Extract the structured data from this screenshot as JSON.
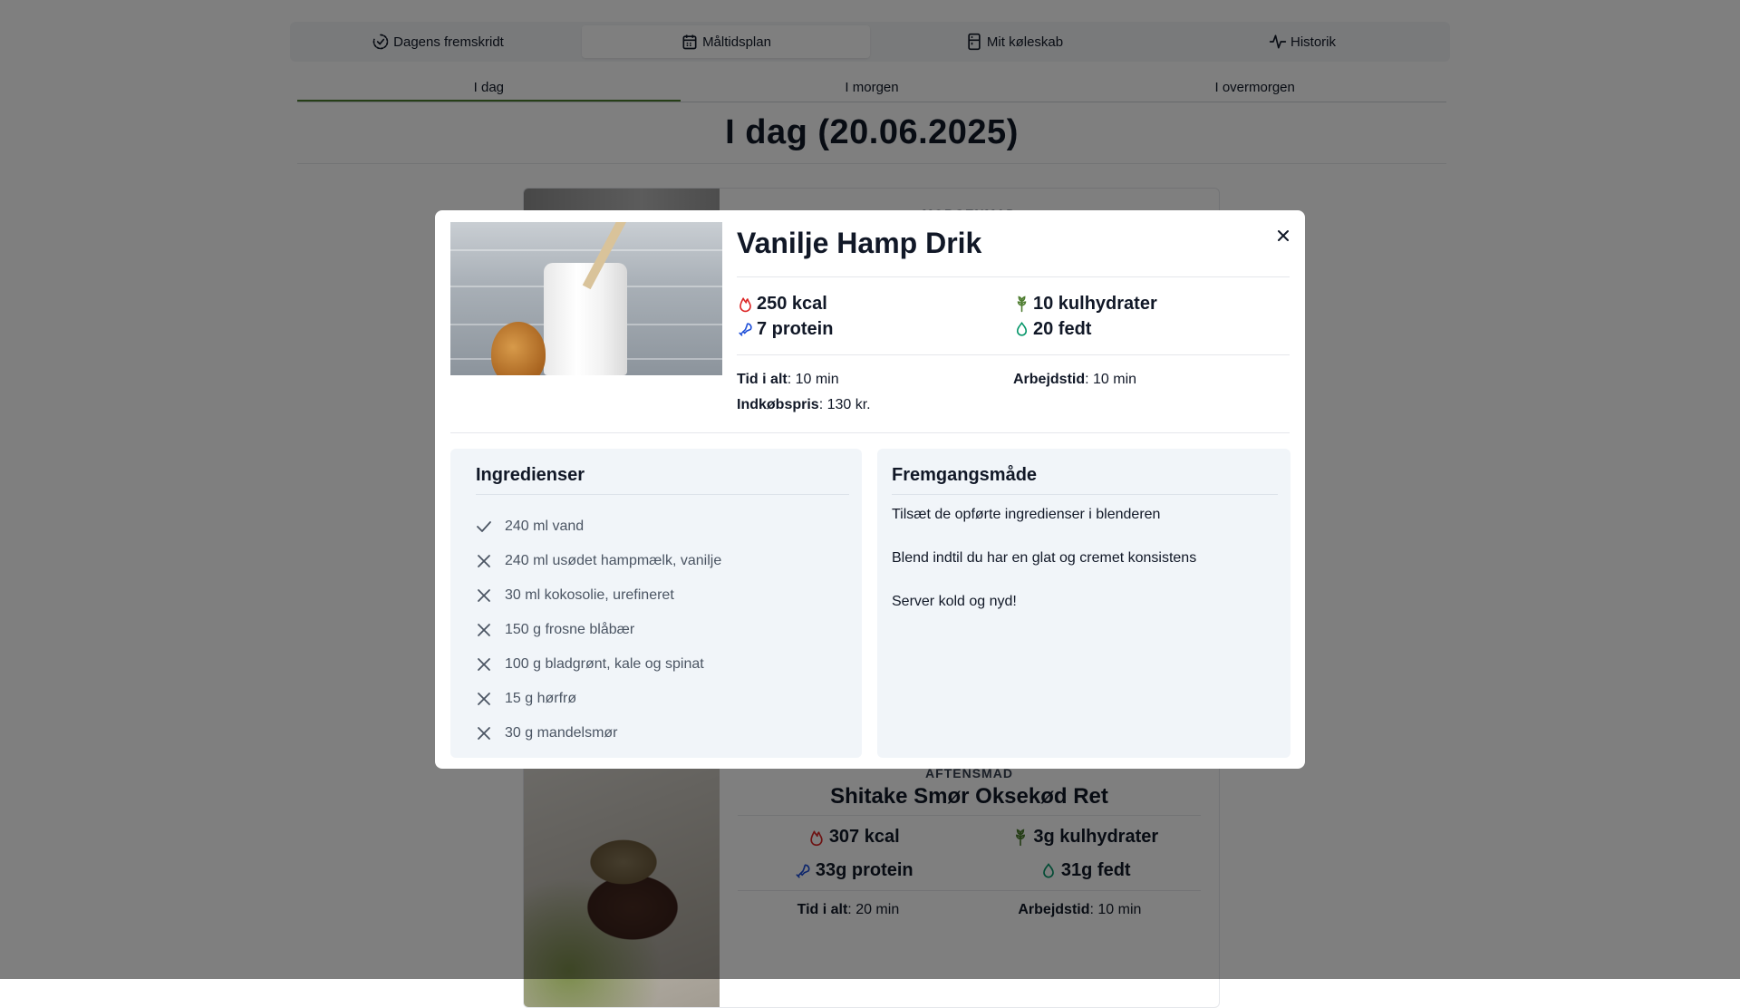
{
  "nav": {
    "items": [
      {
        "label": "Dagens fremskridt",
        "icon": "progress-check-icon",
        "active": false
      },
      {
        "label": "Måltidsplan",
        "icon": "calendar-icon",
        "active": true
      },
      {
        "label": "Mit køleskab",
        "icon": "fridge-icon",
        "active": false
      },
      {
        "label": "Historik",
        "icon": "activity-icon",
        "active": false
      }
    ]
  },
  "day_tabs": [
    "I dag",
    "I morgen",
    "I overmorgen"
  ],
  "day_title": "I dag (20.06.2025)",
  "breakfast": {
    "label": "MORGENMAD"
  },
  "dinner": {
    "label": "AFTENSMAD",
    "title": "Shitake Smør Oksekød Ret",
    "kcal": "307 kcal",
    "carbs": "3g kulhydrater",
    "protein": "33g protein",
    "fat": "31g fedt",
    "total_time_label": "Tid i alt",
    "total_time": ": 20 min",
    "work_time_label": "Arbejdstid",
    "work_time": ": 10 min"
  },
  "modal": {
    "title": "Vanilje Hamp Drik",
    "kcal": "250 kcal",
    "protein": "7 protein",
    "carbs": "10 kulhydrater",
    "fat": "20 fedt",
    "total_time_label": "Tid i alt",
    "total_time": ": 10 min",
    "work_time_label": "Arbejdstid",
    "work_time": ": 10 min",
    "price_label": "Indkøbspris",
    "price": ": 130 kr.",
    "ingredients_title": "Ingredienser",
    "ingredients": [
      {
        "text": "240 ml vand",
        "checked": true
      },
      {
        "text": "240 ml usødet hampmælk, vanilje",
        "checked": false
      },
      {
        "text": "30 ml kokosolie, urefineret",
        "checked": false
      },
      {
        "text": "150 g frosne blåbær",
        "checked": false
      },
      {
        "text": "100 g bladgrønt, kale og spinat",
        "checked": false
      },
      {
        "text": "15 g hørfrø",
        "checked": false
      },
      {
        "text": "30 g mandelsmør",
        "checked": false
      }
    ],
    "steps_title": "Fremgangsmåde",
    "steps": [
      "Tilsæt de opførte ingredienser i blenderen",
      "Blend indtil du har en glat og cremet konsistens",
      "Server kold og nyd!"
    ]
  },
  "colors": {
    "kcal": "#dc2626",
    "carbs": "#4d7c2f",
    "protein": "#1d4ed8",
    "fat": "#059669",
    "active_tab": "#4d7c2f",
    "overlay": "rgba(0,0,0,0.5)"
  }
}
